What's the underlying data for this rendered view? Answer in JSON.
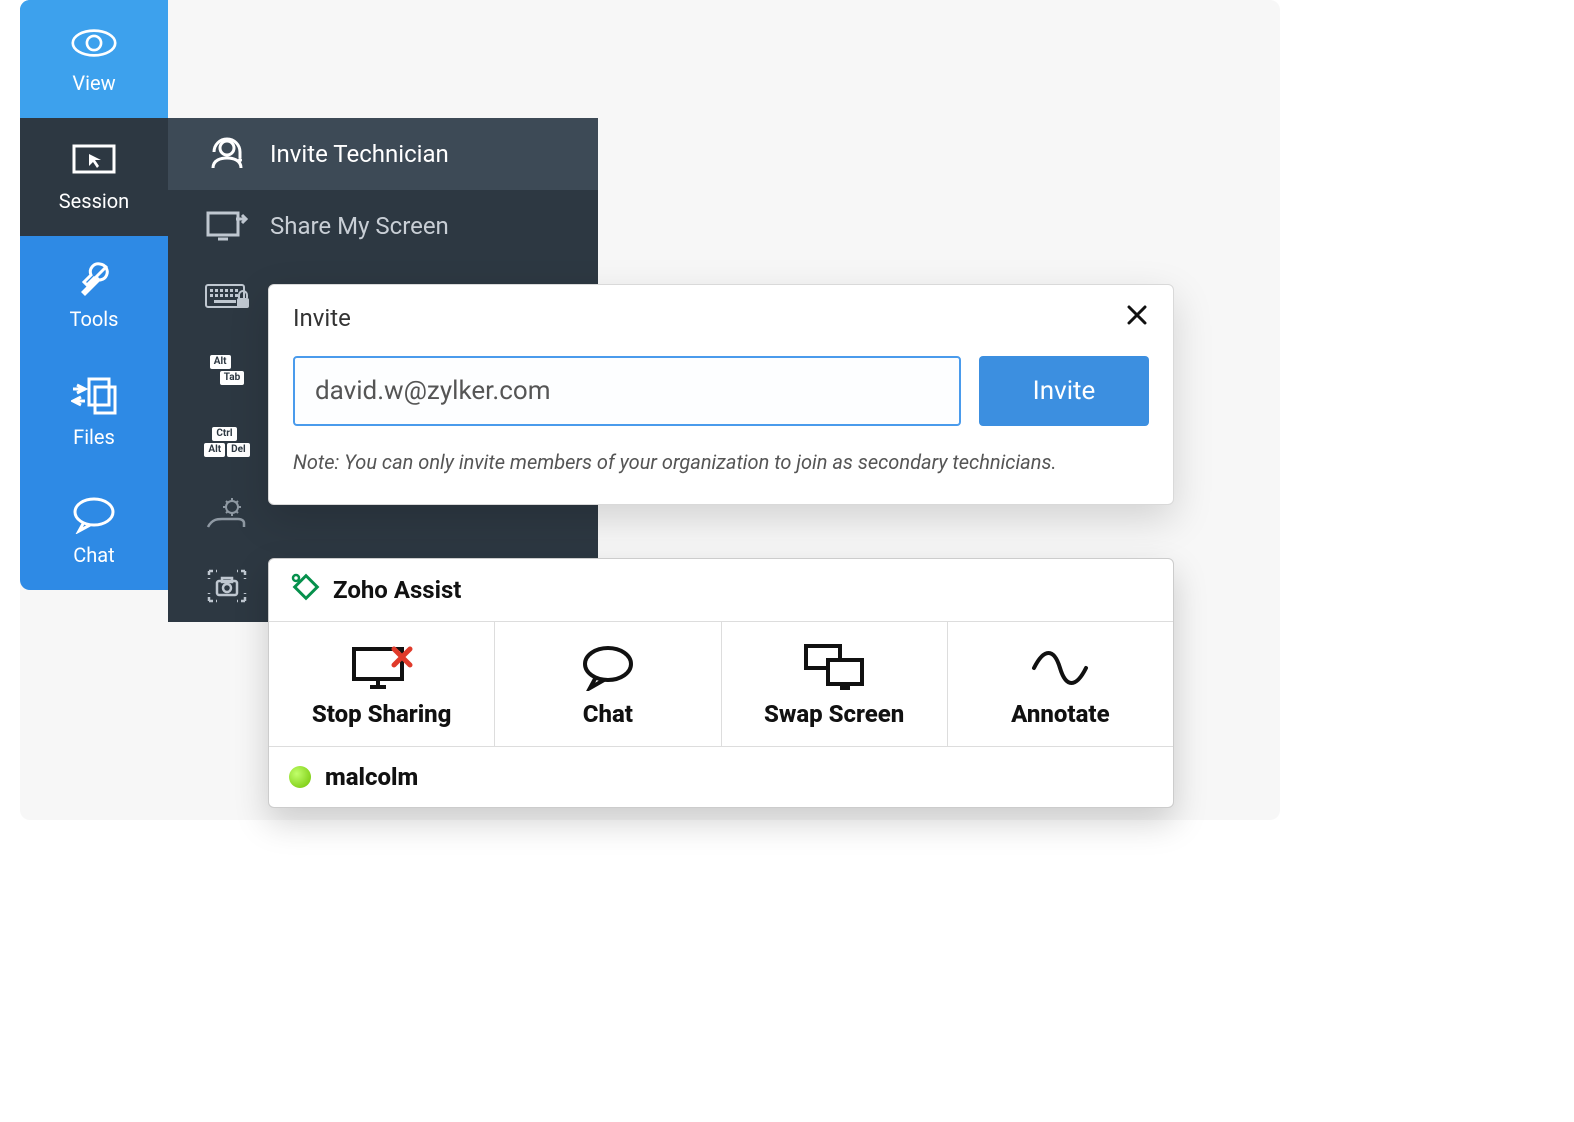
{
  "sidebar": {
    "items": [
      {
        "label": "View"
      },
      {
        "label": "Session"
      },
      {
        "label": "Tools"
      },
      {
        "label": "Files"
      },
      {
        "label": "Chat"
      }
    ]
  },
  "submenu": {
    "items": [
      {
        "label": "Invite Technician"
      },
      {
        "label": "Share My Screen"
      }
    ],
    "key_alt": "Alt",
    "key_tab": "Tab",
    "key_ctrl": "Ctrl",
    "key_del": "Del"
  },
  "invite": {
    "title": "Invite",
    "input_value": "david.w@zylker.com",
    "button_label": "Invite",
    "note": "Note: You can only invite members of your organization to join as secondary technicians."
  },
  "assist": {
    "product_name": "Zoho Assist",
    "actions": [
      {
        "label": "Stop Sharing"
      },
      {
        "label": "Chat"
      },
      {
        "label": "Swap Screen"
      },
      {
        "label": "Annotate"
      }
    ],
    "presence_name": "malcolm",
    "presence_status_color": "#6fc200"
  },
  "colors": {
    "primary": "#2e8ae5",
    "primary_light": "#3da1ed",
    "dark_panel": "#2d3842",
    "button_blue": "#3c8fe0"
  }
}
